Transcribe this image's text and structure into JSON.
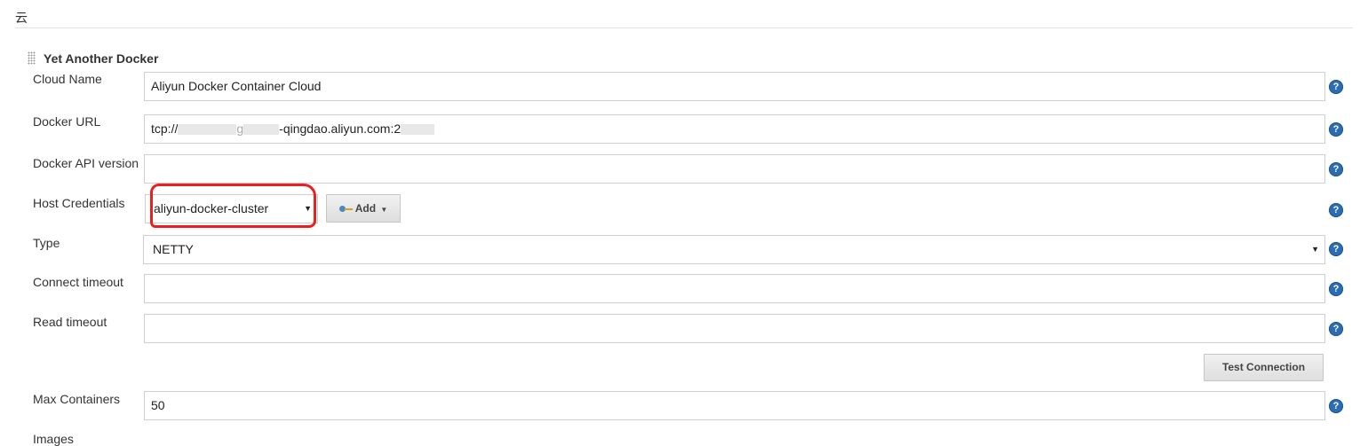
{
  "section": {
    "title": "云"
  },
  "cloud": {
    "title": "Yet Another Docker",
    "fields": {
      "cloud_name": {
        "label": "Cloud Name",
        "value": "Aliyun Docker Container Cloud"
      },
      "docker_url": {
        "label": "Docker URL",
        "prefix": "tcp://",
        "middle": "-qingdao.aliyun.com:2",
        "value_visible": "tcp:// ... -qingdao.aliyun.com:2"
      },
      "docker_api_version": {
        "label": "Docker API version",
        "value": ""
      },
      "host_credentials": {
        "label": "Host Credentials",
        "selected": "aliyun-docker-cluster",
        "add_label": "Add"
      },
      "type": {
        "label": "Type",
        "selected": "NETTY"
      },
      "connect_timeout": {
        "label": "Connect timeout",
        "value": ""
      },
      "read_timeout": {
        "label": "Read timeout",
        "value": ""
      },
      "test_connection": {
        "label": "Test Connection"
      },
      "max_containers": {
        "label": "Max Containers",
        "value": "50"
      },
      "images": {
        "label": "Images"
      }
    }
  },
  "help": {
    "glyph": "?"
  },
  "colors": {
    "help": "#2c6cb2",
    "annotation": "#ea2020",
    "border": "#cfcfcf"
  },
  "icons": {
    "help": "help-circle-icon",
    "credentials": "key-icon",
    "dropdown": "caret-down-icon",
    "handle": "drag-handle-icon"
  }
}
